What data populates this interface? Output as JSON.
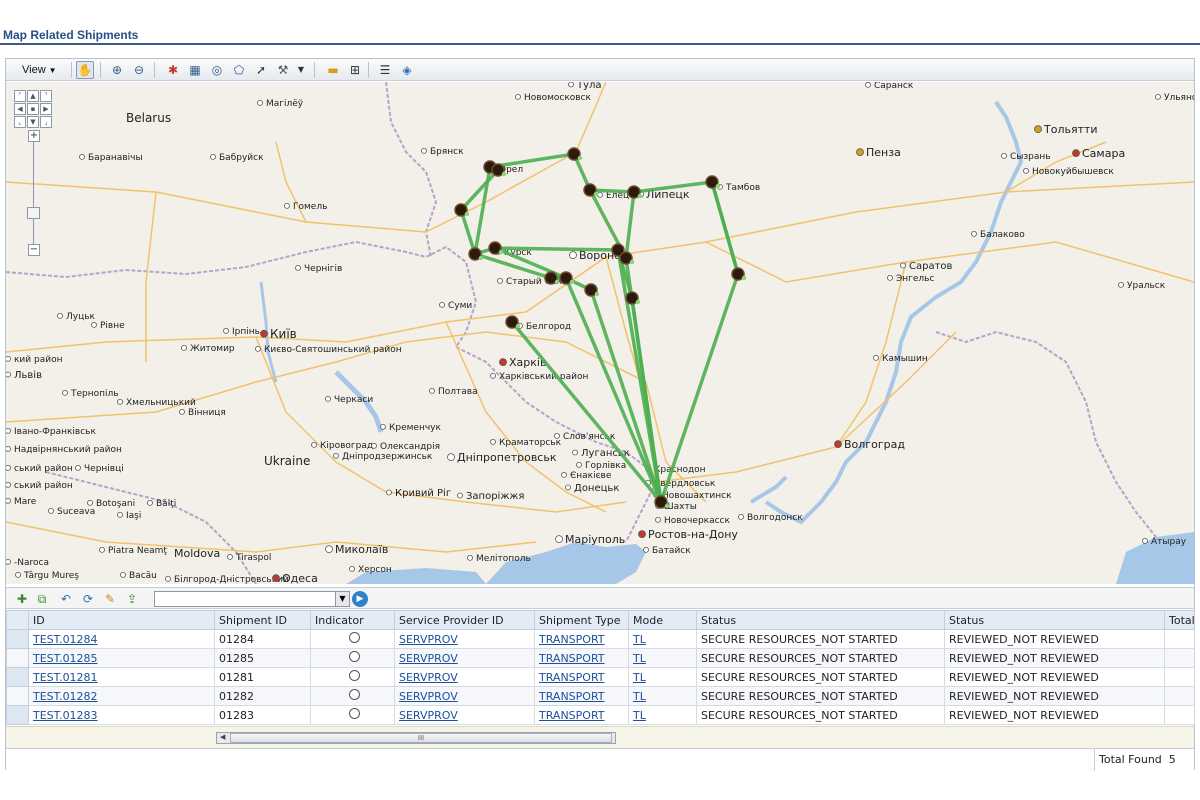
{
  "page": {
    "title": "Map Related Shipments"
  },
  "map_toolbar": {
    "view_label": "View",
    "tools": [
      "pan-hand-icon",
      "zoom-in-icon",
      "zoom-out-icon",
      "marker-icon",
      "select-rect-icon",
      "select-circle-icon",
      "select-polygon-icon",
      "pointer-icon",
      "wrench-icon",
      "ruler-icon",
      "grid-icon",
      "legend-icon",
      "compass-icon"
    ]
  },
  "map": {
    "colors": {
      "route": "#4caf50",
      "water": "#a7c7e9",
      "land": "#f2f0e9",
      "border": "#b7a2c9",
      "road": "#f1c26c"
    },
    "country_labels": {
      "belarus": "Belarus",
      "ukraine": "Ukraine",
      "moldova": "Moldova"
    },
    "cities": {
      "tula": "Тула",
      "novomoskovsk": "Новомосковск",
      "saransk": "Саранск",
      "togliatti": "Тольятти",
      "ulyanovsk": "Ульяновск",
      "samara": "Самара",
      "syzran": "Сызрань",
      "novokuybyshevsk": "Новокуйбышевск",
      "penza": "Пенза",
      "mogilev": "Магілёў",
      "baranovichi": "Баранавічы",
      "bobruisk": "Бабруйск",
      "bryansk": "Брянск",
      "orel": "Орел",
      "yelets": "Елец",
      "lipetsk": "Липецк",
      "tambov": "Тамбов",
      "gomel": "Гомель",
      "balakovo": "Балаково",
      "kursk": "Курск",
      "voronezh": "Воронеж",
      "chernihiv": "Чернігів",
      "saratov": "Саратов",
      "engels": "Энгельс",
      "uralsk": "Уральск",
      "stary_oskol": "Старый Оскол",
      "sumy": "Суми",
      "lutsk": "Луцьк",
      "rivne": "Рівне",
      "belgorod": "Белгород",
      "irpin": "Ірпінь",
      "kyiv": "Київ",
      "kyiv_raion": "Києво-Святошинський район",
      "zhytomyr": "Житомир",
      "kamyshin": "Камышин",
      "raion_left": "кий район",
      "lviv": "Львів",
      "kharkiv": "Харків",
      "kharkiv_raion": "Харківський район",
      "ternopil": "Тернопіль",
      "khmelnytskyi": "Хмельницький",
      "poltava": "Полтава",
      "cherkasy": "Черкаси",
      "vinnytsia": "Вінниця",
      "ivano_frankivsk": "Івано-Франківськ",
      "kremenchuk": "Кременчук",
      "kramatorsk": "Краматорськ",
      "sloviansk": "Слов'янськ",
      "volgograd": "Волгоград",
      "nadvirna_raion": "Надвірнянський район",
      "kropyvnytskyi": "Кіровоград",
      "oleksandriia": "Олександрія",
      "luhansk": "Луганськ",
      "raion_left2": "ський район",
      "dnipro_raion": "Дніпродзержинськ",
      "dnipropetrovsk": "Дніпропетровськ",
      "horlivka": "Горлівка",
      "chernivtsi": "Чернівці",
      "yenakiieve": "Єнакієве",
      "krasnodon": "Краснодон",
      "sverdlovsk": "Свердловськ",
      "kolomyia_raion": "ський район",
      "donetsk": "Донецьк",
      "novoshakhtinsk": "Новошахтинск",
      "shakhty": "Шахты",
      "kryvyi_rih": "Кривий Ріг",
      "zaporizhzhia": "Запоріжжя",
      "botosani": "Botoşani",
      "balti": "Bălţi",
      "volgodonsk": "Волгодонск",
      "novocherkassk": "Новочеркасск",
      "suceava": "Suceava",
      "iasi": "Iaşi",
      "mariupol": "Маріуполь",
      "rostov": "Ростов-на-Дону",
      "bataysk": "Батайск",
      "piatra_neamt": "Piatra Neamţ",
      "mykolaiv": "Миколаїв",
      "melitopol": "Мелітополь",
      "atyrau": "Атырау",
      "tiraspol": "Tiraspol",
      "naroca": "-Naroca",
      "kherson": "Херсон",
      "targu_mures": "Târgu Mureş",
      "bacau": "Bacău",
      "bilhorod": "Білгород-Дністровський",
      "odesa": "Одеса",
      "mare": "Mare"
    }
  },
  "grid_toolbar": {
    "icons": [
      "add-row-icon",
      "copy-row-icon",
      "undo-icon",
      "refresh-icon",
      "edit-icon",
      "export-icon"
    ],
    "filter_value": ""
  },
  "table": {
    "headers": {
      "id": "ID",
      "shipment_id": "Shipment ID",
      "indicator": "Indicator",
      "provider": "Service Provider ID",
      "type": "Shipment Type",
      "mode": "Mode",
      "status": "Status",
      "status2": "Status",
      "total": "Total"
    },
    "rows": [
      {
        "id": "TEST.01284",
        "shipment_id": "01284",
        "provider": "SERVPROV",
        "type": "TRANSPORT",
        "mode": "TL",
        "status": "SECURE RESOURCES_NOT STARTED",
        "status2": "REVIEWED_NOT REVIEWED"
      },
      {
        "id": "TEST.01285",
        "shipment_id": "01285",
        "provider": "SERVPROV",
        "type": "TRANSPORT",
        "mode": "TL",
        "status": "SECURE RESOURCES_NOT STARTED",
        "status2": "REVIEWED_NOT REVIEWED"
      },
      {
        "id": "TEST.01281",
        "shipment_id": "01281",
        "provider": "SERVPROV",
        "type": "TRANSPORT",
        "mode": "TL",
        "status": "SECURE RESOURCES_NOT STARTED",
        "status2": "REVIEWED_NOT REVIEWED"
      },
      {
        "id": "TEST.01282",
        "shipment_id": "01282",
        "provider": "SERVPROV",
        "type": "TRANSPORT",
        "mode": "TL",
        "status": "SECURE RESOURCES_NOT STARTED",
        "status2": "REVIEWED_NOT REVIEWED"
      },
      {
        "id": "TEST.01283",
        "shipment_id": "01283",
        "provider": "SERVPROV",
        "type": "TRANSPORT",
        "mode": "TL",
        "status": "SECURE RESOURCES_NOT STARTED",
        "status2": "REVIEWED_NOT REVIEWED"
      }
    ]
  },
  "scrollbar": {
    "thumb_grip": "III"
  },
  "footer": {
    "total_label": "Total Found",
    "total_value": "5"
  }
}
